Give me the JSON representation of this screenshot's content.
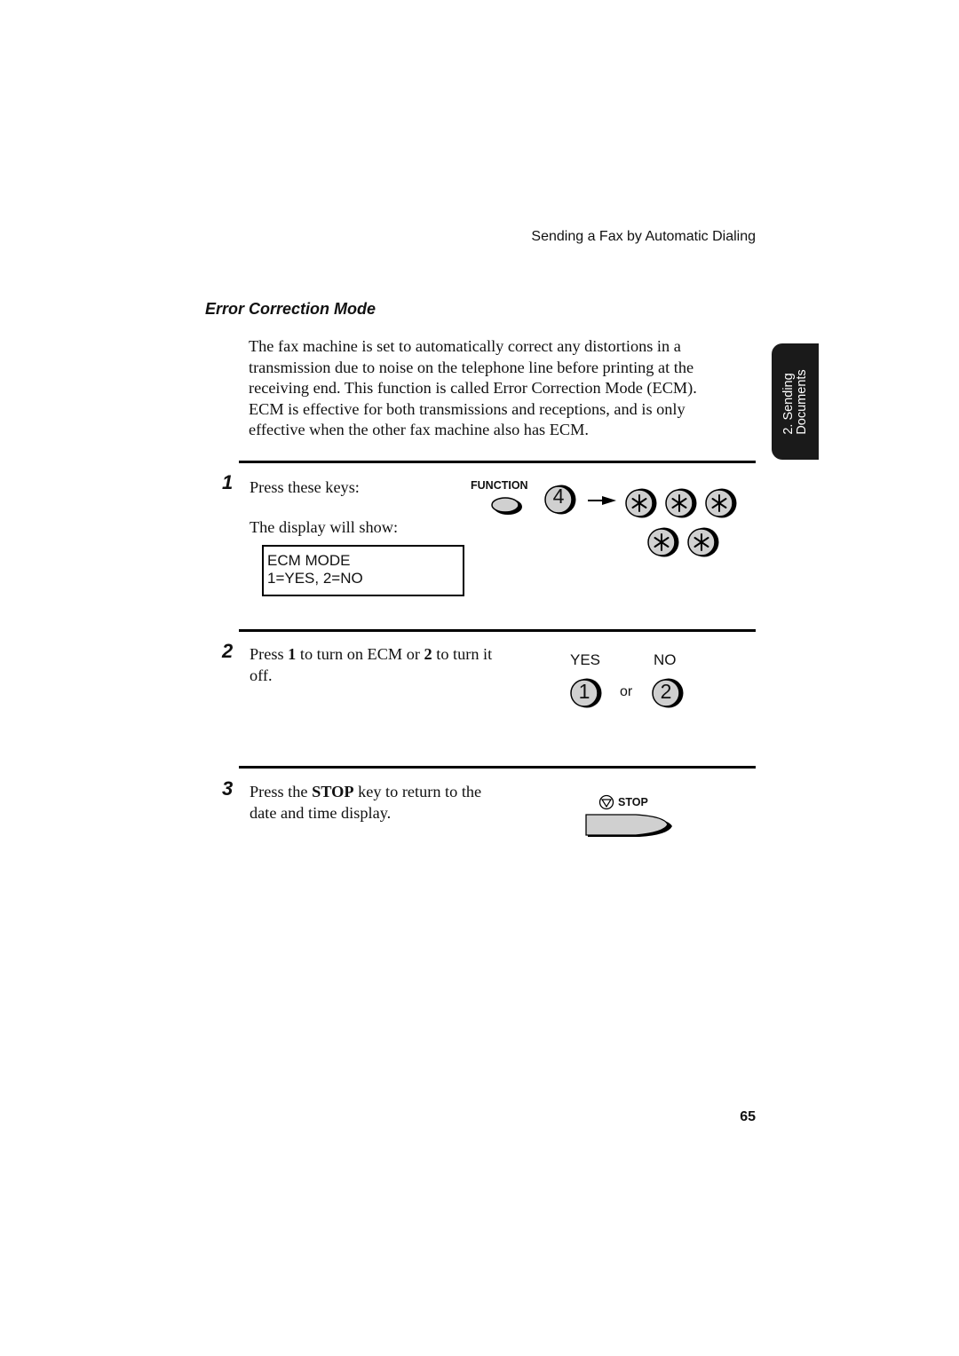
{
  "header": {
    "running_title": "Sending a Fax by Automatic Dialing"
  },
  "section": {
    "title": "Error Correction Mode",
    "intro_lines": [
      "The fax machine is set to automatically correct any distortions in a",
      "transmission due to noise on the telephone line before printing at the",
      "receiving end. This function is called Error Correction Mode (ECM).",
      "ECM is effective for both transmissions and receptions, and is only",
      "effective when the other fax machine also has ECM."
    ]
  },
  "side_tab": {
    "line1": "2. Sending",
    "line2": "Documents"
  },
  "steps": [
    {
      "number": "1",
      "text": "Press these keys:",
      "subtext": "The display will show:",
      "display": {
        "line1": "ECM MODE",
        "line2": "1=YES, 2=NO"
      },
      "keys": {
        "function_label": "FUNCTION",
        "digit": "4",
        "arrow_icon": "right-arrow-icon",
        "star_key_count": 5,
        "star_glyph": "*"
      }
    },
    {
      "number": "2",
      "text_parts": [
        "Press ",
        "1",
        " to turn on ECM or ",
        "2",
        " to turn it"
      ],
      "text_line2": "off.",
      "keys": {
        "yes_label": "YES",
        "no_label": "NO",
        "key1": "1",
        "key2": "2",
        "or_text": "or"
      }
    },
    {
      "number": "3",
      "text_parts": [
        "Press the ",
        "STOP",
        " key to return to the"
      ],
      "text_line2": "date and time display.",
      "keys": {
        "stop_label": "STOP",
        "stop_icon": "stop-icon"
      }
    }
  ],
  "footer": {
    "page_number": "65"
  }
}
